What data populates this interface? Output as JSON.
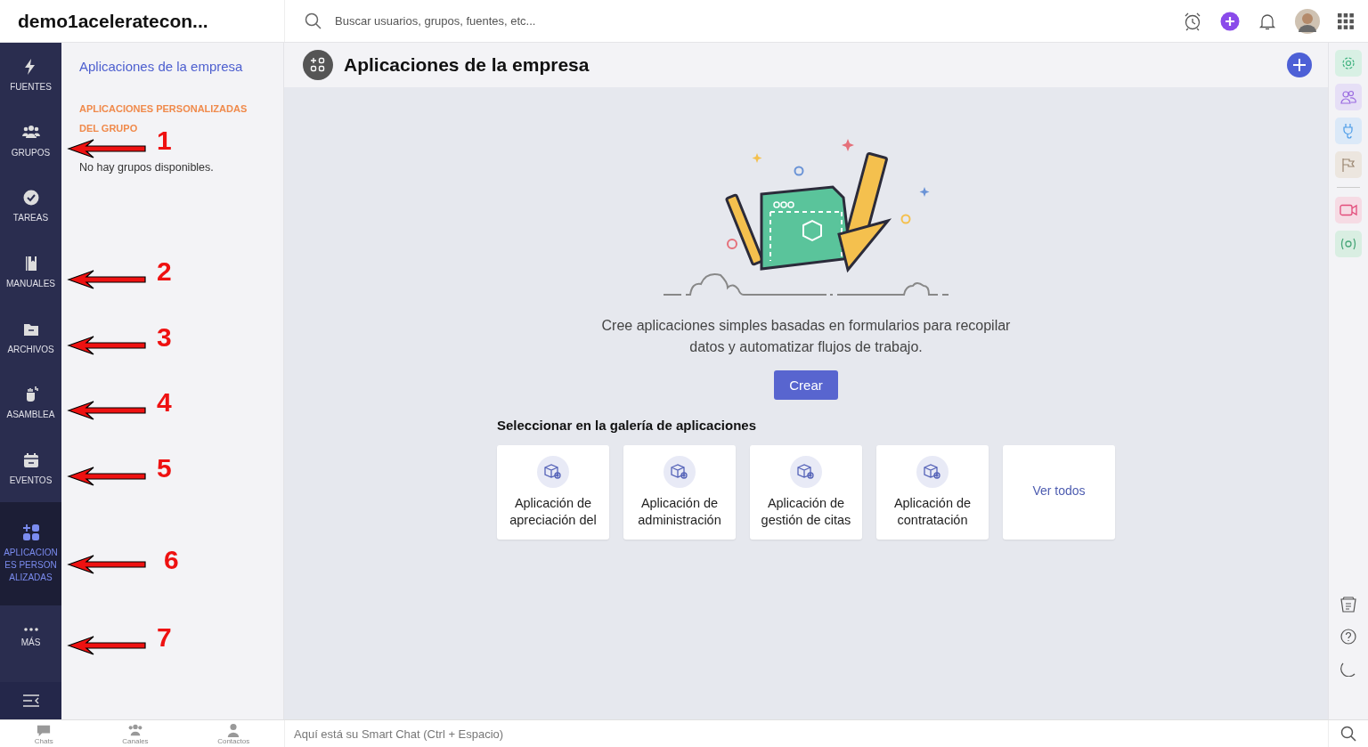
{
  "brand": "demo1aceleratecon...",
  "search": {
    "placeholder": "Buscar usuarios, grupos, fuentes, etc..."
  },
  "nav": [
    {
      "kind": "bolt",
      "label": "FUENTES",
      "selected": false
    },
    {
      "kind": "groups",
      "label": "GRUPOS",
      "selected": false,
      "annotation": "1"
    },
    {
      "kind": "check",
      "label": "TAREAS",
      "selected": false
    },
    {
      "kind": "book",
      "label": "MANUALES",
      "selected": false,
      "annotation": "2"
    },
    {
      "kind": "folder",
      "label": "ARCHIVOS",
      "selected": false,
      "annotation": "3"
    },
    {
      "kind": "hand",
      "label": "ASAMBLEA",
      "selected": false,
      "annotation": "4"
    },
    {
      "kind": "calendar",
      "label": "EVENTOS",
      "selected": false,
      "annotation": "5"
    },
    {
      "kind": "apps",
      "label": "APLICACIONES PERSONALIZADAS",
      "selected": true,
      "annotation": "6"
    },
    {
      "kind": "more",
      "label": "MÁS",
      "selected": false,
      "annotation": "7"
    }
  ],
  "panel": {
    "link": "Aplicaciones de la empresa",
    "section": "APLICACIONES PERSONALIZADAS DEL GRUPO",
    "empty": "No hay grupos disponibles."
  },
  "main": {
    "title": "Aplicaciones de la empresa",
    "description": "Cree aplicaciones simples basadas en formularios para recopilar datos y automatizar flujos de trabajo.",
    "create": "Crear",
    "gallery_title": "Seleccionar en la galería de aplicaciones",
    "cards": [
      {
        "kind": "app",
        "label": "Aplicación de apreciación del"
      },
      {
        "kind": "app",
        "label": "Aplicación de administración"
      },
      {
        "kind": "app",
        "label": "Aplicación de gestión de citas"
      },
      {
        "kind": "app",
        "label": "Aplicación de contratación"
      },
      {
        "kind": "link",
        "label": "Ver todos"
      }
    ]
  },
  "bottom": {
    "tabs": [
      "Chats",
      "Canales",
      "Contactos"
    ],
    "chat_placeholder": "Aquí está su Smart Chat (Ctrl + Espacio)"
  }
}
